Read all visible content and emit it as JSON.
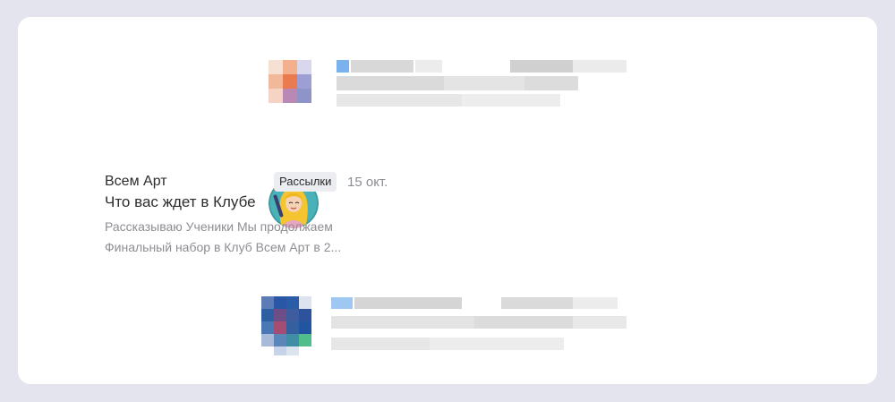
{
  "messages": [
    {
      "state": "blurred"
    },
    {
      "state": "visible",
      "sender": "Всем Арт",
      "subject": "Что вас ждет в Клубе",
      "category_badge": "Рассылки",
      "date": "15 окт.",
      "snippet_line1": "Рассказываю Ученики Мы продолжаем",
      "snippet_line2": "Финальный набор в Клуб Всем Арт в 2..."
    },
    {
      "state": "blurred"
    }
  ],
  "colors": {
    "background": "#e4e4ef",
    "card": "#ffffff",
    "badge_bg": "#ebedf0",
    "text_primary": "#2c2d2e",
    "text_secondary": "#8c8e93"
  },
  "icons": [
    "avatar-illustration-girl-with-brush"
  ]
}
